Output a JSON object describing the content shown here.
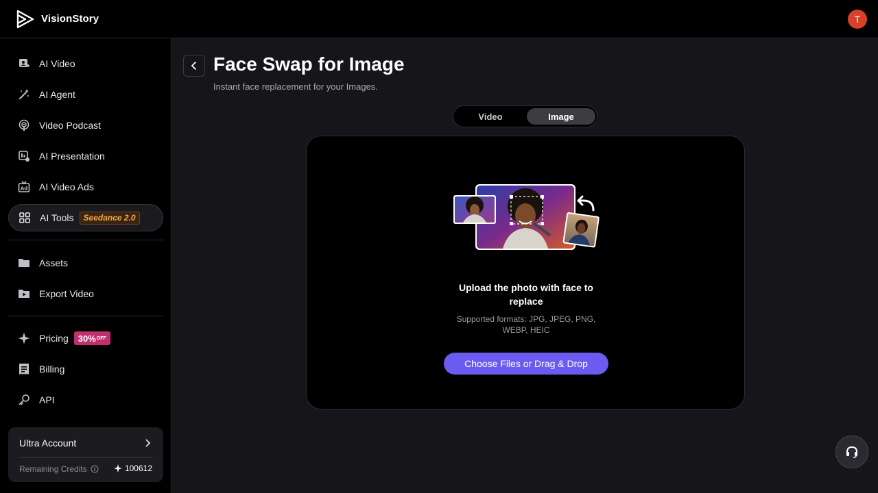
{
  "brand": {
    "name": "VisionStory"
  },
  "user": {
    "avatar_initial": "T"
  },
  "sidebar": {
    "items": [
      {
        "label": "AI Video"
      },
      {
        "label": "AI Agent"
      },
      {
        "label": "Video Podcast"
      },
      {
        "label": "AI Presentation"
      },
      {
        "label": "AI Video Ads"
      },
      {
        "label": "AI Tools",
        "badge": "Seedance 2.0",
        "active": true
      },
      {
        "label": "Assets"
      },
      {
        "label": "Export Video"
      },
      {
        "label": "Pricing",
        "badge": "30%",
        "badge_sub": "OFF"
      },
      {
        "label": "Billing"
      },
      {
        "label": "API"
      }
    ],
    "account": {
      "title": "Ultra Account",
      "credits_label": "Remaining Credits",
      "credits_value": "100612"
    }
  },
  "main": {
    "title": "Face Swap for Image",
    "subtitle": "Instant face replacement for your Images.",
    "tabs": [
      {
        "label": "Video",
        "selected": false
      },
      {
        "label": "Image",
        "selected": true
      }
    ],
    "upload": {
      "title": "Upload the photo with face to replace",
      "formats": "Supported formats: JPG, JPEG, PNG, WEBP, HEIC",
      "button_label": "Choose Files or Drag & Drop"
    }
  },
  "colors": {
    "accent": "#6a5cf0",
    "avatar": "#d9402b",
    "badge_pink": "#c0306e",
    "badge_orange": "#f4a84a"
  }
}
